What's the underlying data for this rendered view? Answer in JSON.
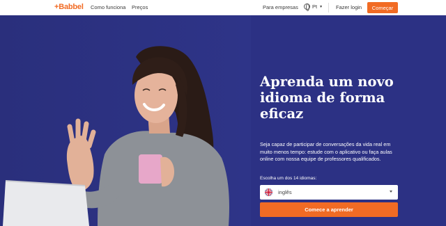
{
  "header": {
    "logo": "+Babbel",
    "nav": {
      "how": "Como funciona",
      "prices": "Preços"
    },
    "business": "Para empresas",
    "language": "Pt",
    "login": "Fazer login",
    "start": "Começar"
  },
  "hero": {
    "title": "Aprenda um novo idioma de forma eficaz",
    "subtitle": "Seja capaz de participar de conversações da vida real em muito menos tempo: estude com o aplicativo ou faça aulas online com nossa equipe de professores qualificados.",
    "choose_label": "Escolha um dos 14 idiomas:",
    "selected_language": "inglês",
    "cta": "Comece a aprender"
  },
  "colors": {
    "accent": "#f16b24",
    "hero_bg": "#2c3184",
    "white": "#ffffff"
  }
}
